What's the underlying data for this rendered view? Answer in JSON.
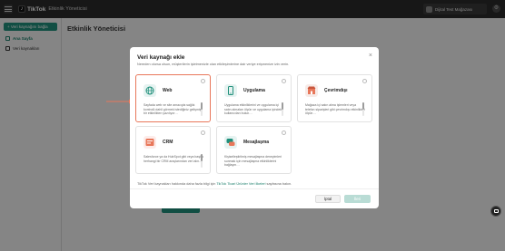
{
  "header": {
    "logo_mark": "♪",
    "logo_text": "TikTok",
    "logo_sub": "Etkinlik Yöneticisi",
    "account_name": "Dijital Test Mağazası",
    "settings_icon": "gear-icon"
  },
  "sidebar": {
    "add_button_label": "+ Veri kaynağını bağla",
    "items": [
      {
        "label": "Ana Sayfa",
        "icon": "home-icon"
      },
      {
        "label": "Veri kaynakları",
        "icon": "list-icon"
      }
    ]
  },
  "page": {
    "title": "Etkinlik Yöneticisi"
  },
  "modal": {
    "title": "Veri kaynağı ekle",
    "description": "Nereden olursa olsun, müşterilerin işletmenizle olan etkileşimlerine dair veriye erişmenize izin verin.",
    "cards": [
      {
        "title": "Web",
        "desc": "Sayfada web ve site amacıyla sağlık kontrolü dahil görmek istediğiniz gelişmiş bir etkinlikten yazılıyor…",
        "selected": true,
        "icon": "web-icon"
      },
      {
        "title": "Uygulama",
        "desc": "Uygulama etkinliklerini ve uygulama içi satın almaları ölçün ve uygulama içindeki kullanıcıları bulun…",
        "selected": false,
        "icon": "app-icon"
      },
      {
        "title": "Çevrimdışı",
        "desc": "Mağaza içi satın alma işlemleri veya telefon siparişleri gibi çevrimdışı etkinlikleri ölçün…",
        "selected": false,
        "icon": "offline-icon"
      },
      {
        "title": "CRM",
        "desc": "Salesforce ya da HubSpot gibi veya başka herhangi bir CRM araçlarından veri alın…",
        "selected": false,
        "icon": "crm-icon"
      },
      {
        "title": "Mesajlaşma",
        "desc": "Kişiselleştirilmiş mesajlaşma deneyimleri sunmak için mesajlaşma etkinliklerini bağlayın…",
        "selected": false,
        "icon": "messaging-icon"
      }
    ],
    "footnote_prefix": "TikTok Veri kaynakları hakkında daha fazla bilgi için",
    "footnote_link": "TikTok Ticari Ürünler Veri İlkeleri",
    "footnote_suffix": "sayfasına bakın.",
    "cancel_label": "İptal",
    "next_label": "İleri"
  },
  "colors": {
    "accent": "#1f8f7a",
    "highlight": "#e8775a"
  }
}
